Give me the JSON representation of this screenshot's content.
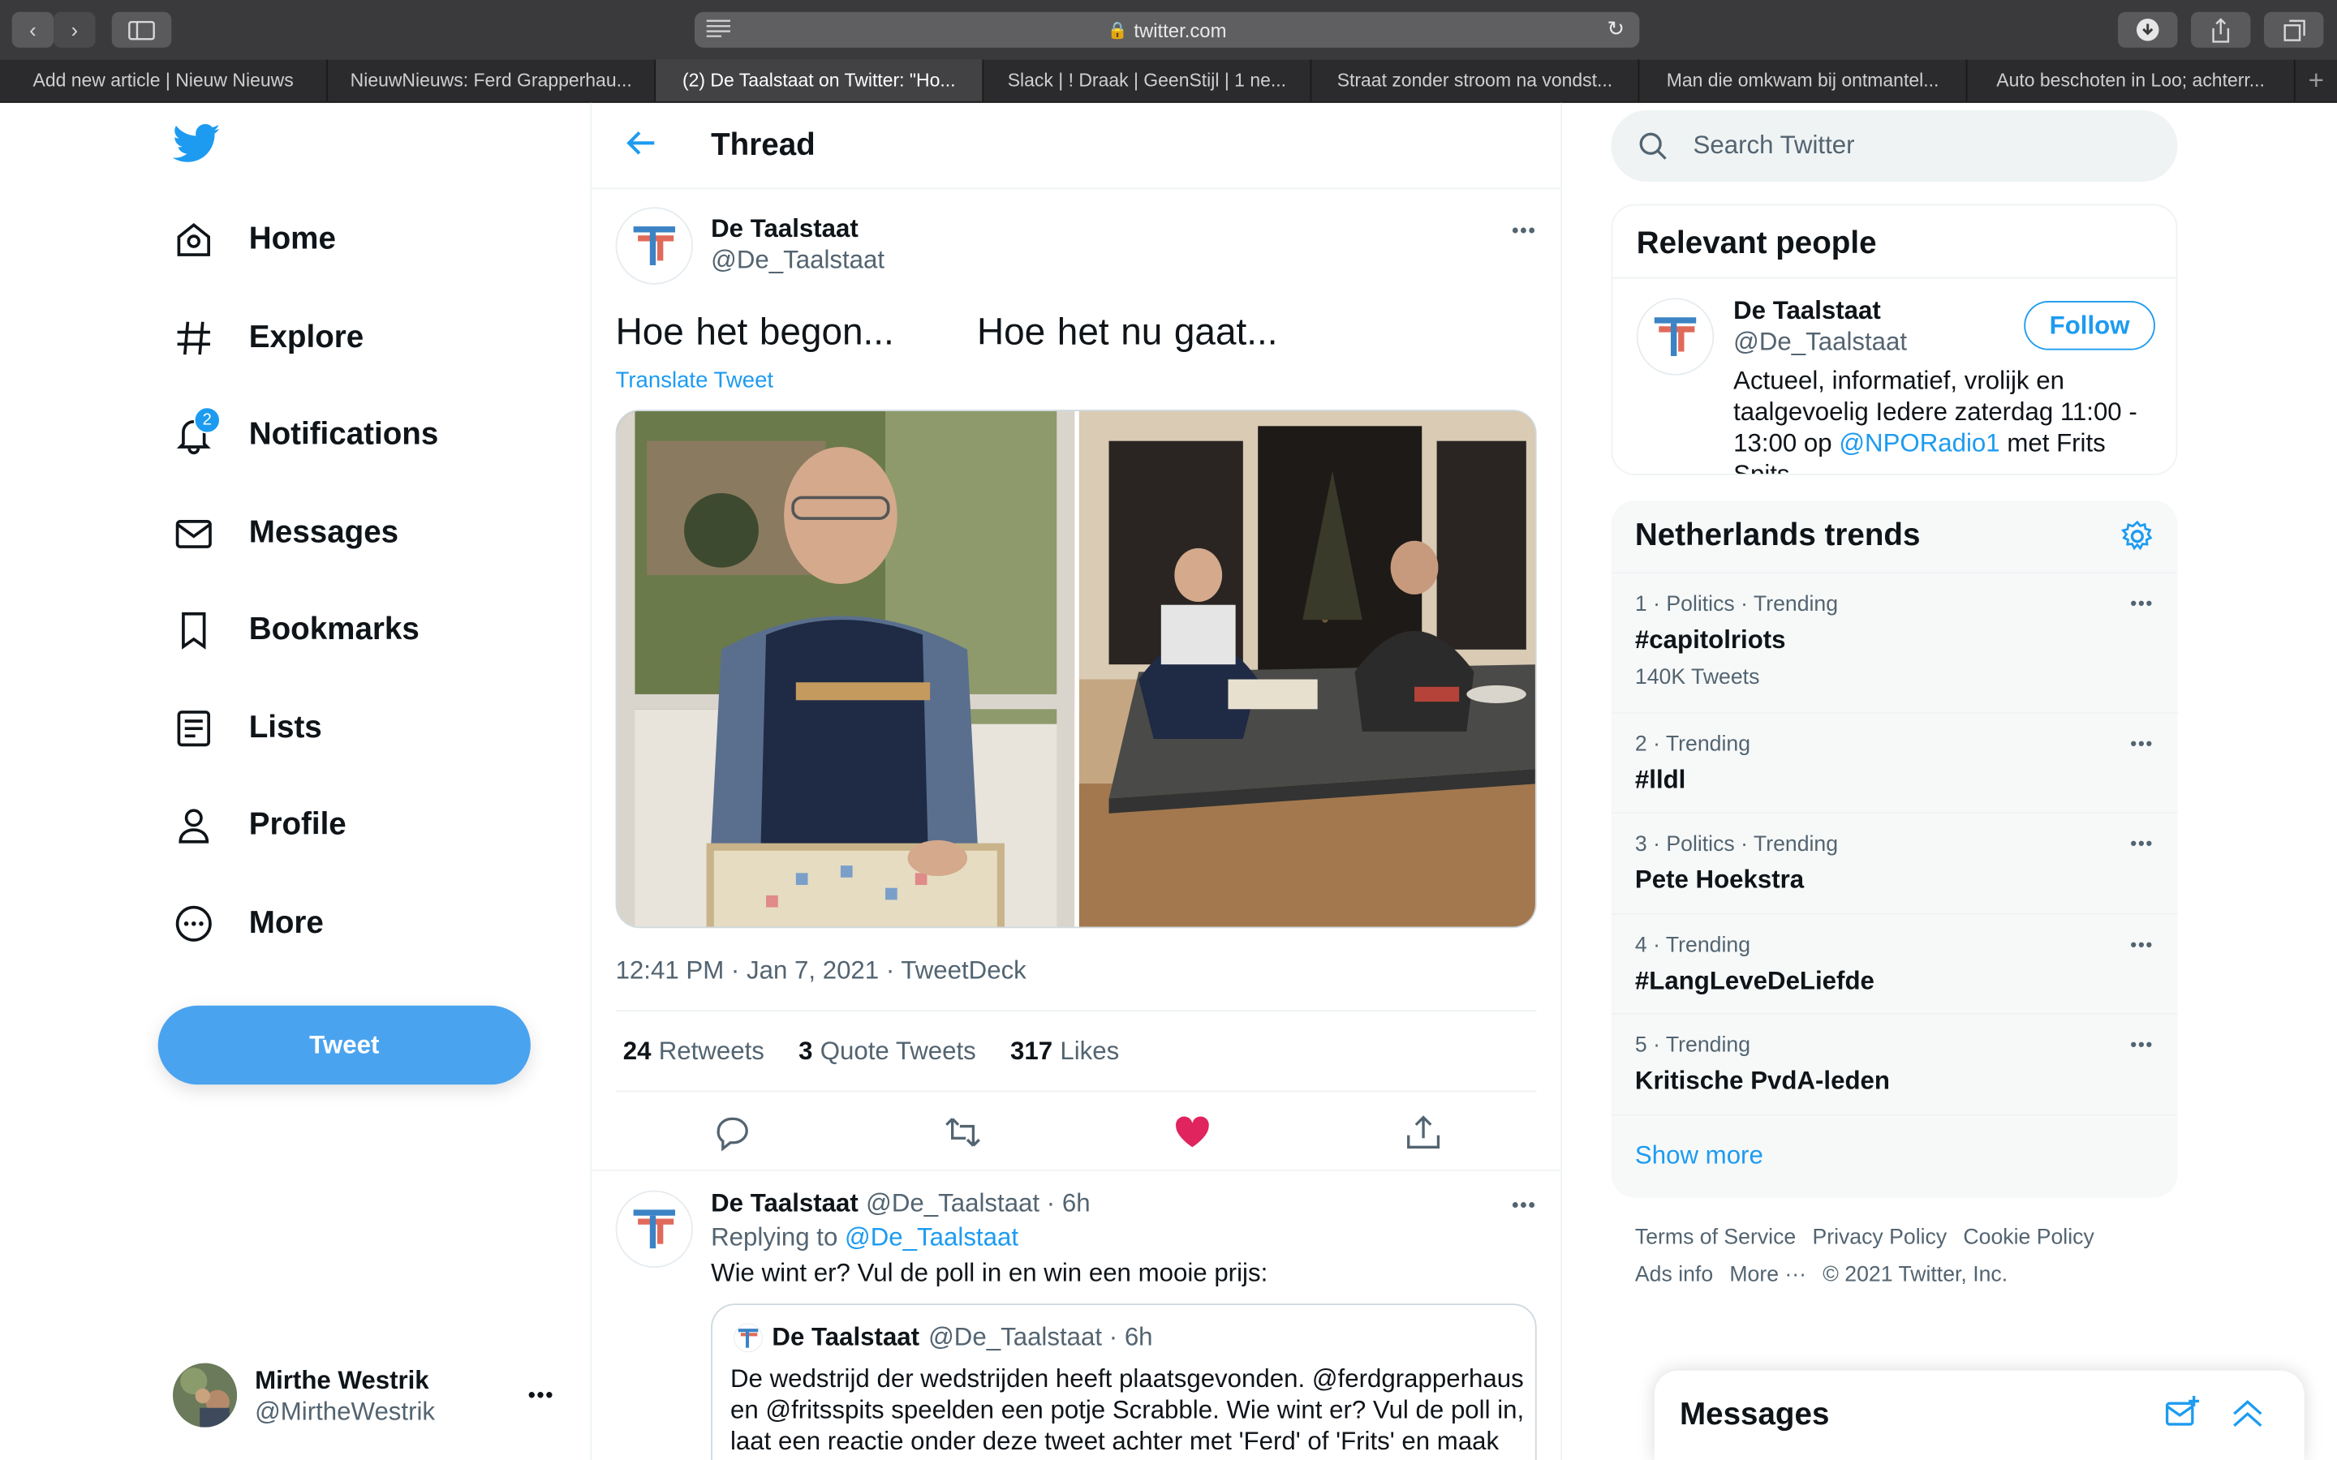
{
  "browser": {
    "url": "twitter.com",
    "tabs": [
      "Add new article | Nieuw Nieuws",
      "NieuwNieuws: Ferd Grapperhau...",
      "(2) De Taalstaat on Twitter: \"Ho...",
      "Slack | ! Draak | GeenStijl | 1 ne...",
      "Straat zonder stroom na vondst...",
      "Man die omkwam bij ontmantel...",
      "Auto beschoten in Loo; achterr..."
    ],
    "active_tab": 2
  },
  "nav": {
    "items": [
      "Home",
      "Explore",
      "Notifications",
      "Messages",
      "Bookmarks",
      "Lists",
      "Profile",
      "More"
    ],
    "notifications_badge": "2",
    "tweet_button": "Tweet",
    "account": {
      "name": "Mirthe Westrik",
      "handle": "@MirtheWestrik"
    }
  },
  "main": {
    "title": "Thread",
    "tweet": {
      "name": "De Taalstaat",
      "handle": "@De_Taalstaat",
      "text": "Hoe het begon...       Hoe het nu gaat...",
      "translate": "Translate Tweet",
      "meta": "12:41 PM · Jan 7, 2021 · TweetDeck",
      "retweets": "24",
      "retweets_label": "Retweets",
      "quotes": "3",
      "quotes_label": "Quote Tweets",
      "likes": "317",
      "likes_label": "Likes"
    },
    "reply": {
      "name": "De Taalstaat",
      "handle_time": "@De_Taalstaat · 6h",
      "replying_prefix": "Replying to",
      "replying_handle": "@De_Taalstaat",
      "text": "Wie wint er? Vul de poll in en win een mooie prijs:",
      "quote": {
        "name": "De Taalstaat",
        "handle_time": "@De_Taalstaat · 6h",
        "text": "De wedstrijd der wedstrijden heeft plaatsgevonden. @ferdgrapperhaus en @fritsspits speelden een potje Scrabble. Wie wint er? Vul de poll in, laat een reactie onder deze tweet achter met 'Ferd' of 'Frits' en maak"
      }
    }
  },
  "right": {
    "search_placeholder": "Search Twitter",
    "relevant": {
      "title": "Relevant people",
      "name": "De Taalstaat",
      "handle": "@De_Taalstaat",
      "follow": "Follow",
      "bio_before": "Actueel, informatief, vrolijk en taalgevoelig Iedere zaterdag 11:00 - 13:00 op ",
      "bio_link": "@NPORadio1",
      "bio_after": " met Frits Spits"
    },
    "trends": {
      "title": "Netherlands trends",
      "items": [
        {
          "meta": "1 · Politics · Trending",
          "name": "#capitolriots",
          "count": "140K Tweets"
        },
        {
          "meta": "2 · Trending",
          "name": "#lldl",
          "count": ""
        },
        {
          "meta": "3 · Politics · Trending",
          "name": "Pete Hoekstra",
          "count": ""
        },
        {
          "meta": "4 · Trending",
          "name": "#LangLeveDeLiefde",
          "count": ""
        },
        {
          "meta": "5 · Trending",
          "name": "Kritische PvdA-leden",
          "count": ""
        }
      ],
      "show_more": "Show more"
    },
    "footer": [
      "Terms of Service",
      "Privacy Policy",
      "Cookie Policy",
      "Ads info",
      "More ···",
      "© 2021 Twitter, Inc."
    ],
    "messages_dock": "Messages"
  },
  "colors": {
    "accent": "#1d9bf0",
    "like": "#e0245e",
    "tweet_button": "#4aa3ef"
  }
}
